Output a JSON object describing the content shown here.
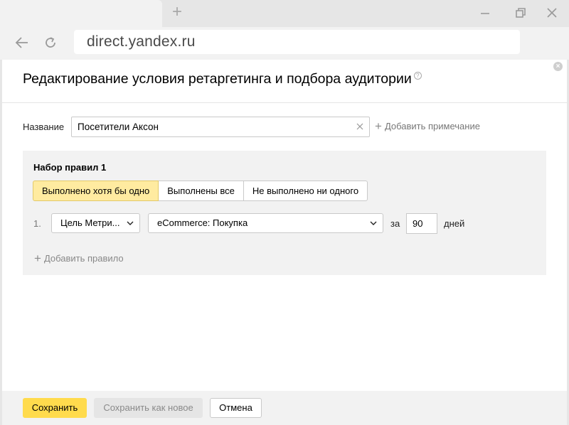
{
  "browser": {
    "new_tab_symbol": "+",
    "url": "direct.yandex.ru",
    "icons": [
      "back-arrow-icon",
      "reload-icon",
      "minimize-icon",
      "restore-icon",
      "close-icon"
    ]
  },
  "modal": {
    "title": "Редактирование условия ретаргетинга и подбора аудитории",
    "help_symbol": "?",
    "name_label": "Название",
    "name_value": "Посетители Аксон",
    "add_note_label": "Добавить примечание",
    "ruleset": {
      "title": "Набор правил 1",
      "modes": [
        "Выполнено хотя бы одно",
        "Выполнены все",
        "Не выполнено ни одного"
      ],
      "active_mode": "Выполнено хотя бы одно",
      "rules": [
        {
          "number": "1.",
          "type": "Цель Метри...",
          "goal": "eCommerce: Покупка",
          "for_label": "за",
          "days": "90",
          "days_label": "дней"
        }
      ],
      "add_rule_label": "Добавить правило"
    },
    "footer": {
      "save_label": "Сохранить",
      "save_new_label": "Сохранить как новое",
      "cancel_label": "Отмена"
    }
  },
  "colors": {
    "accent_yellow": "#ffdb4d",
    "active_segment": "#ffeba0",
    "panel_gray": "#f2f2f2"
  }
}
